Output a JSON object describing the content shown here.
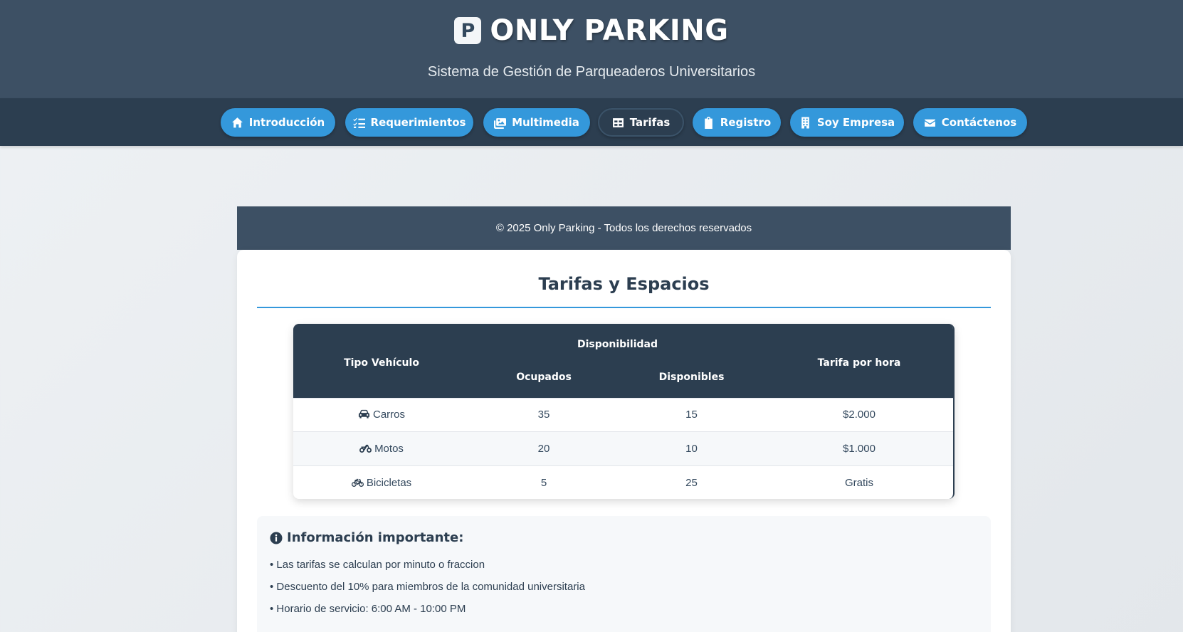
{
  "header": {
    "logo_letter": "P",
    "title": "ONLY PARKING",
    "subtitle": "Sistema de Gestión de Parqueaderos Universitarios"
  },
  "nav": {
    "items": [
      {
        "label": "Introducción",
        "icon": "home-icon"
      },
      {
        "label": "Requerimientos",
        "icon": "list-check-icon"
      },
      {
        "label": "Multimedia",
        "icon": "images-icon"
      },
      {
        "label": "Tarifas",
        "icon": "table-icon",
        "active": true
      },
      {
        "label": "Registro",
        "icon": "clipboard-icon"
      },
      {
        "label": "Soy Empresa",
        "icon": "building-icon"
      },
      {
        "label": "Contáctenos",
        "icon": "envelope-icon"
      }
    ]
  },
  "footer": {
    "copyright": "© 2025 Only Parking - Todos los derechos reservados"
  },
  "section": {
    "title": "Tarifas y Espacios"
  },
  "table": {
    "headers": {
      "vehicle": "Tipo Vehículo",
      "availability": "Disponibilidad",
      "occupied": "Ocupados",
      "available": "Disponibles",
      "rate": "Tarifa por hora"
    },
    "rows": [
      {
        "vehicle": "Carros",
        "icon": "car-icon",
        "occupied": "35",
        "available": "15",
        "rate": "$2.000"
      },
      {
        "vehicle": "Motos",
        "icon": "motorcycle-icon",
        "occupied": "20",
        "available": "10",
        "rate": "$1.000"
      },
      {
        "vehicle": "Bicicletas",
        "icon": "bicycle-icon",
        "occupied": "5",
        "available": "25",
        "rate": "Gratis"
      }
    ]
  },
  "info": {
    "title": "Información importante:",
    "icon": "info-circle-icon",
    "items": [
      "• Las tarifas se calculan por minuto o fraccion",
      "• Descuento del 10% para miembros de la comunidad universitaria",
      "• Horario de servicio: 6:00 AM - 10:00 PM"
    ]
  },
  "colors": {
    "header_bg": "#3d5064",
    "nav_bg": "#2c3e50",
    "accent": "#3498db",
    "text_dark": "#2c3e50"
  }
}
